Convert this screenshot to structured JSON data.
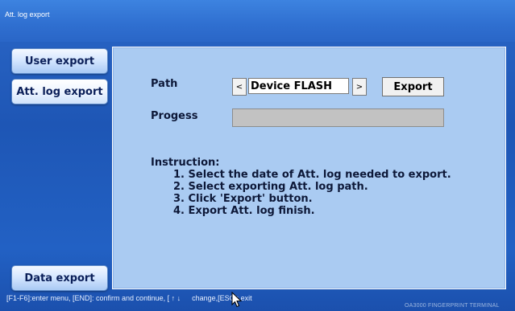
{
  "window": {
    "title": "Att. log export"
  },
  "sidebar": {
    "items": [
      {
        "label": "User export"
      },
      {
        "label": "Att. log export",
        "active": true
      },
      {
        "label": "Data export"
      }
    ]
  },
  "main": {
    "path_label": "Path",
    "path_value": "Device FLASH",
    "path_prev": "<",
    "path_next": ">",
    "export_label": "Export",
    "progress_label": "Progess",
    "progress_value": 0,
    "instruction_title": "Instruction:",
    "instructions": [
      "1. Select the date of Att. log needed to export.",
      "2. Select exporting Att. log path.",
      "3. Click 'Export' button.",
      "4. Export Att. log finish."
    ]
  },
  "footer": {
    "hint_before_cursor": "[F1-F6]:enter menu, [END]: confirm and continue, [ ↑ ↓",
    "hint_after_cursor": "change,[ESC]: exit",
    "brand": "OA3000 FINGERPRINT TERMINAL"
  },
  "colors": {
    "background": "#1e56b5",
    "panel": "#aacbf2",
    "button_text": "#0a1e58"
  }
}
